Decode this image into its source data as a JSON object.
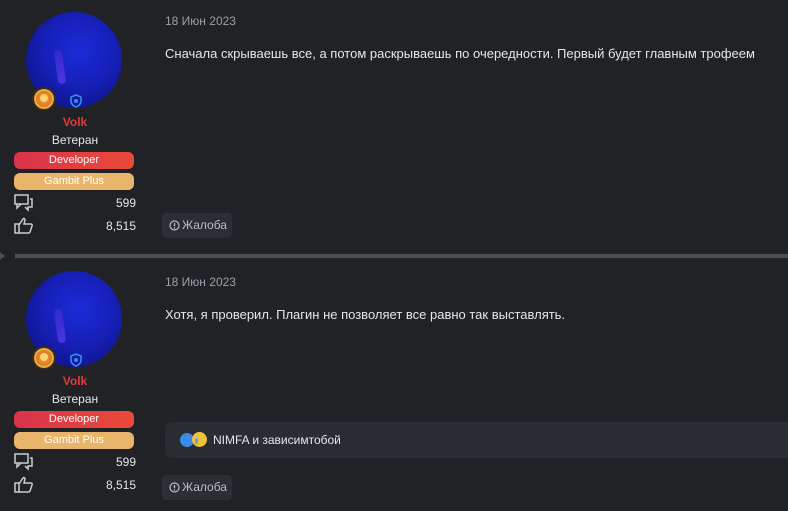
{
  "posts": [
    {
      "author": {
        "username": "Volk",
        "title": "Ветеран",
        "banners": [
          "Developer",
          "Gambit Plus"
        ],
        "messages": "599",
        "reactions": "8,515"
      },
      "date": "18 Июн 2023",
      "text": "Сначала скрываешь все, а потом раскрываешь по очередности. Первый будет главным трофеем",
      "report_label": "Жалоба"
    },
    {
      "author": {
        "username": "Volk",
        "title": "Ветеран",
        "banners": [
          "Developer",
          "Gambit Plus"
        ],
        "messages": "599",
        "reactions": "8,515"
      },
      "date": "18 Июн 2023",
      "text": "Хотя, я проверил. Плагин не позволяет все равно так выставлять.",
      "reactions_text": "NIMFA и зависимтобой",
      "report_label": "Жалоба"
    }
  ],
  "icons": {
    "messages": "messages-icon",
    "likes": "thumbs-up-icon",
    "report": "info-circle-icon",
    "award": "award-badge-icon",
    "shield": "shield-icon"
  },
  "colors": {
    "background": "#202226",
    "username": "#e03a3a",
    "developer_banner": "#e03a3a",
    "gambit_banner": "#e9b56a",
    "divider": "#4a4e56"
  }
}
